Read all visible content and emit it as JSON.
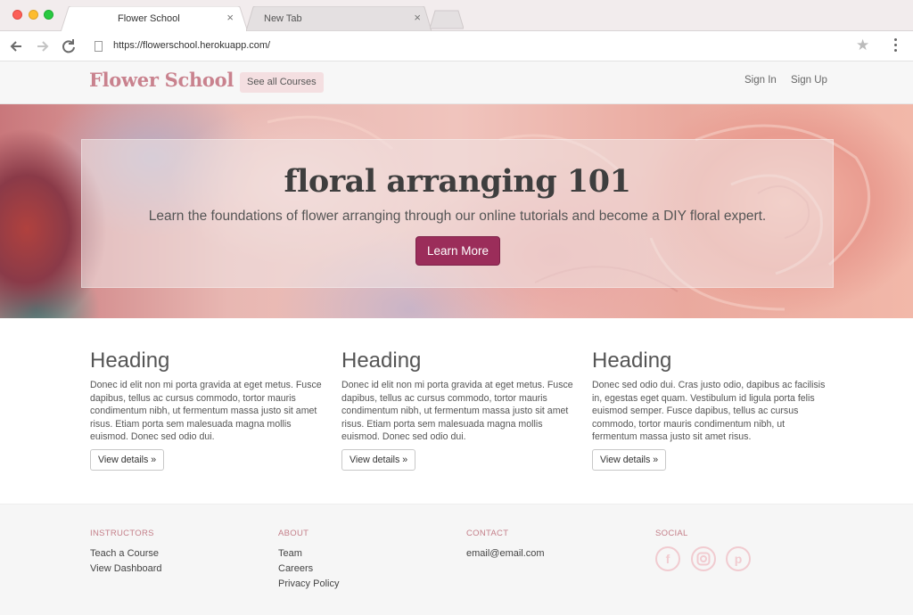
{
  "browser": {
    "tabs": [
      {
        "title": "Flower School",
        "close": "×"
      },
      {
        "title": "New Tab",
        "close": "×"
      }
    ],
    "url": "https://flowerschool.herokuapp.com/"
  },
  "nav": {
    "brand": "Flower School",
    "courses_button": "See all Courses",
    "sign_in": "Sign In",
    "sign_up": "Sign Up"
  },
  "hero": {
    "title": "floral arranging 101",
    "subtitle": "Learn the foundations of flower arranging through our online tutorials and become a DIY floral expert.",
    "button": "Learn More"
  },
  "features": [
    {
      "heading": "Heading",
      "text": "Donec id elit non mi porta gravida at eget metus. Fusce dapibus, tellus ac cursus commodo, tortor mauris condimentum nibh, ut fermentum massa justo sit amet risus. Etiam porta sem malesuada magna mollis euismod. Donec sed odio dui.",
      "button": "View details »"
    },
    {
      "heading": "Heading",
      "text": "Donec id elit non mi porta gravida at eget metus. Fusce dapibus, tellus ac cursus commodo, tortor mauris condimentum nibh, ut fermentum massa justo sit amet risus. Etiam porta sem malesuada magna mollis euismod. Donec sed odio dui.",
      "button": "View details »"
    },
    {
      "heading": "Heading",
      "text": "Donec sed odio dui. Cras justo odio, dapibus ac facilisis in, egestas eget quam. Vestibulum id ligula porta felis euismod semper. Fusce dapibus, tellus ac cursus commodo, tortor mauris condimentum nibh, ut fermentum massa justo sit amet risus.",
      "button": "View details »"
    }
  ],
  "footer": {
    "instructors": {
      "heading": "INSTRUCTORS",
      "links": [
        "Teach a Course",
        "View Dashboard"
      ]
    },
    "about": {
      "heading": "ABOUT",
      "links": [
        "Team",
        "Careers",
        "Privacy Policy"
      ]
    },
    "contact": {
      "heading": "CONTACT",
      "email": "email@email.com"
    },
    "social": {
      "heading": "SOCIAL",
      "icons": [
        "facebook-icon",
        "instagram-icon",
        "pinterest-icon"
      ]
    }
  },
  "colors": {
    "brand": "#c9828e",
    "primary_button": "#9b2d5a",
    "footer_heading": "#c47f89"
  }
}
